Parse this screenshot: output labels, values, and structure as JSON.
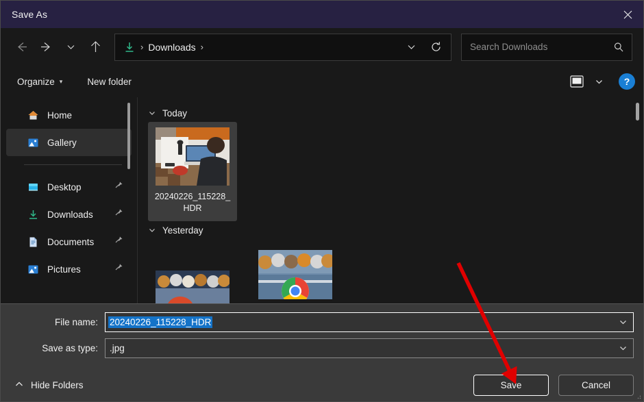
{
  "window": {
    "title": "Save As",
    "close_label": "Close",
    "close_icon": "close-icon"
  },
  "nav": {
    "back_label": "Back",
    "forward_label": "Forward",
    "recent_label": "Recent locations",
    "up_label": "Up to Desktop",
    "refresh_label": "Refresh",
    "address_chevron_label": "Previous locations"
  },
  "address": {
    "folder_icon": "downloads-icon",
    "separator": "›",
    "crumb": "Downloads",
    "trailing_separator": "›"
  },
  "search": {
    "placeholder": "Search Downloads",
    "value": "",
    "icon": "search-icon"
  },
  "command_bar": {
    "organize_label": "Organize",
    "organize_caret": "▾",
    "new_folder_label": "New folder",
    "view_icon": "view-layout-icon",
    "view_chevron": "chevron-down-icon",
    "help_label": "?"
  },
  "sidebar": {
    "items": [
      {
        "label": "Home",
        "icon": "home-icon",
        "selected": false,
        "pinned": false
      },
      {
        "label": "Gallery",
        "icon": "gallery-icon",
        "selected": true,
        "pinned": false
      },
      {
        "label": "Desktop",
        "icon": "desktop-icon",
        "selected": false,
        "pinned": true
      },
      {
        "label": "Downloads",
        "icon": "downloads-icon",
        "selected": false,
        "pinned": true
      },
      {
        "label": "Documents",
        "icon": "documents-icon",
        "selected": false,
        "pinned": true
      },
      {
        "label": "Pictures",
        "icon": "pictures-icon",
        "selected": false,
        "pinned": true
      }
    ]
  },
  "content": {
    "groups": [
      {
        "label": "Today",
        "expanded": true
      },
      {
        "label": "Yesterday",
        "expanded": true
      }
    ],
    "files": [
      {
        "name": "20240226_115228_HDR",
        "selected": true,
        "thumb": "photo-desk-workstation"
      }
    ],
    "yesterday_thumbs": [
      {
        "thumb": "cartoon-animals-partial"
      },
      {
        "thumb": "chrome-logo-animals-partial"
      }
    ]
  },
  "form": {
    "filename_label": "File name:",
    "filename_value": "20240226_115228_HDR",
    "filetype_label": "Save as type:",
    "filetype_value": ".jpg",
    "chevron_icon": "chevron-down-icon"
  },
  "footer": {
    "hide_folders_label": "Hide Folders",
    "hide_folders_chevron": "chevron-up-icon",
    "save_label": "Save",
    "cancel_label": "Cancel"
  },
  "annotation": {
    "arrow_color": "#e00000",
    "points_to": "Save"
  },
  "colors": {
    "titlebar": "#272142",
    "content_bg": "#191919",
    "panel_bg": "#3a3a3a",
    "selection_blue": "#1473c8",
    "accent_help": "#1a7fd4",
    "annotation_red": "#e00000"
  }
}
